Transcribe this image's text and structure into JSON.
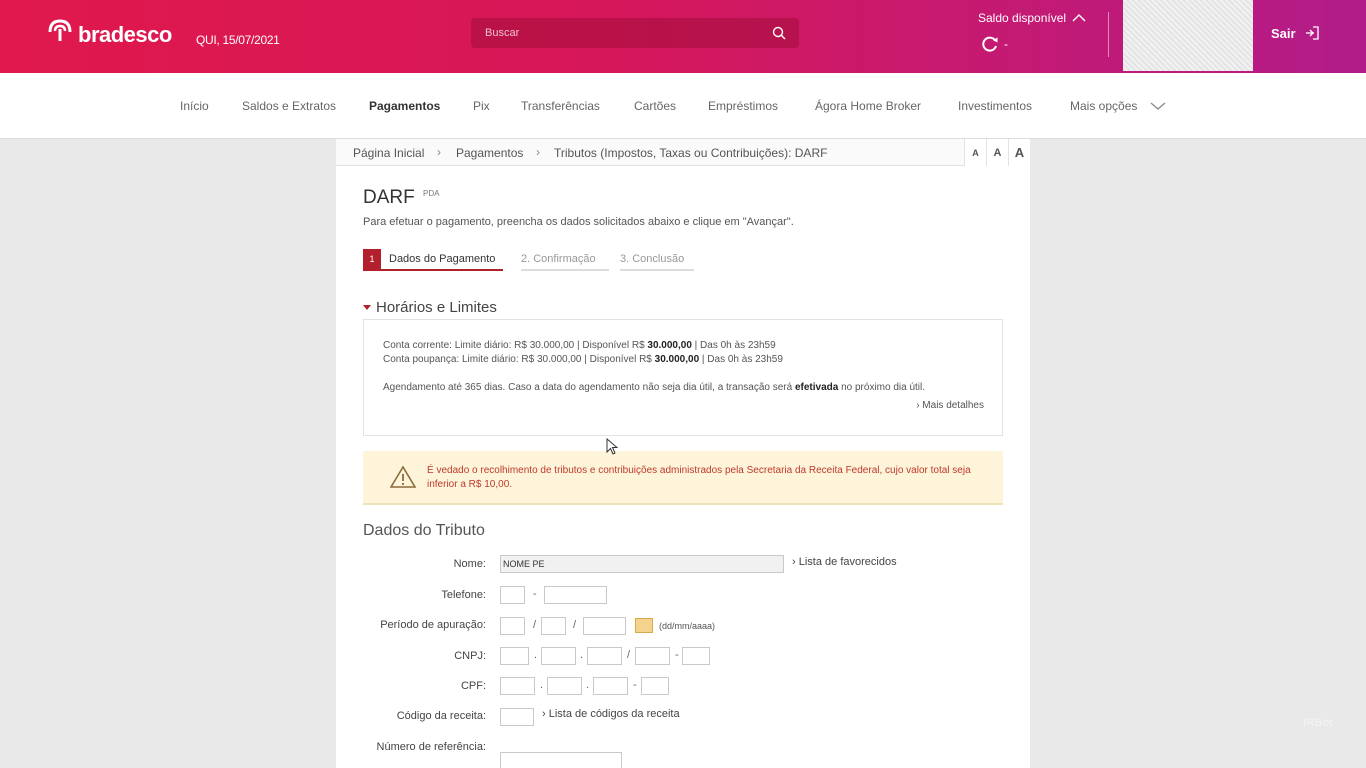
{
  "header": {
    "brand": "bradesco",
    "date": "QUI, 15/07/2021",
    "search_placeholder": "Buscar",
    "saldo_label": "Saldo disponível",
    "saldo_value": "-",
    "logout_label": "Sair",
    "brand_color": "#e0184c"
  },
  "nav": {
    "items": [
      "Início",
      "Saldos e Extratos",
      "Pagamentos",
      "Pix",
      "Transferências",
      "Cartões",
      "Empréstimos",
      "Ágora Home Broker",
      "Investimentos",
      "Mais opções"
    ],
    "active": "Pagamentos"
  },
  "breadcrumb": [
    "Página Inicial",
    "Pagamentos",
    "Tributos (Impostos, Taxas ou Contribuições): DARF"
  ],
  "font_sizes": [
    "A",
    "A",
    "A"
  ],
  "page": {
    "title": "DARF",
    "badge": "PDA",
    "subtitle": "Para efetuar o pagamento, preencha os dados solicitados abaixo e clique em \"Avançar\".",
    "steps": [
      {
        "num": "1",
        "label": "Dados do Pagamento"
      },
      {
        "label": "2. Confirmação"
      },
      {
        "label": "3. Conclusão"
      }
    ]
  },
  "limits": {
    "heading": "Horários e Limites",
    "corrente_a": "Conta corrente: Limite diário: R$ 30.000,00 | Disponível R$ ",
    "corrente_b": "30.000,00",
    "corrente_c": " | Das 0h às 23h59",
    "poupanca_a": "Conta poupança: Limite diário: R$ 30.000,00 | Disponível R$ ",
    "poupanca_b": "30.000,00",
    "poupanca_c": " | Das 0h às 23h59",
    "agend_a": "Agendamento até 365 dias. Caso a data do agendamento não seja dia útil, a transação será ",
    "agend_b": "efetivada",
    "agend_c": " no próximo dia útil.",
    "more": "Mais detalhes"
  },
  "warning": "É vedado o recolhimento de tributos e contribuições administrados pela Secretaria da Receita Federal, cujo valor total seja inferior a R$ 10,00.",
  "tributo": {
    "heading": "Dados do Tributo",
    "nome_label": "Nome:",
    "nome_value": "NOME PE",
    "favorecidos": "Lista de favorecidos",
    "telefone_label": "Telefone:",
    "periodo_label": "Período de apuração:",
    "periodo_hint": "(dd/mm/aaaa)",
    "cnpj_label": "CNPJ:",
    "cpf_label": "CPF:",
    "codigo_label": "Código da receita:",
    "codigos_link": "Lista de códigos da receita",
    "referencia_label": "Número de referência:"
  },
  "watermark": "IRBot"
}
